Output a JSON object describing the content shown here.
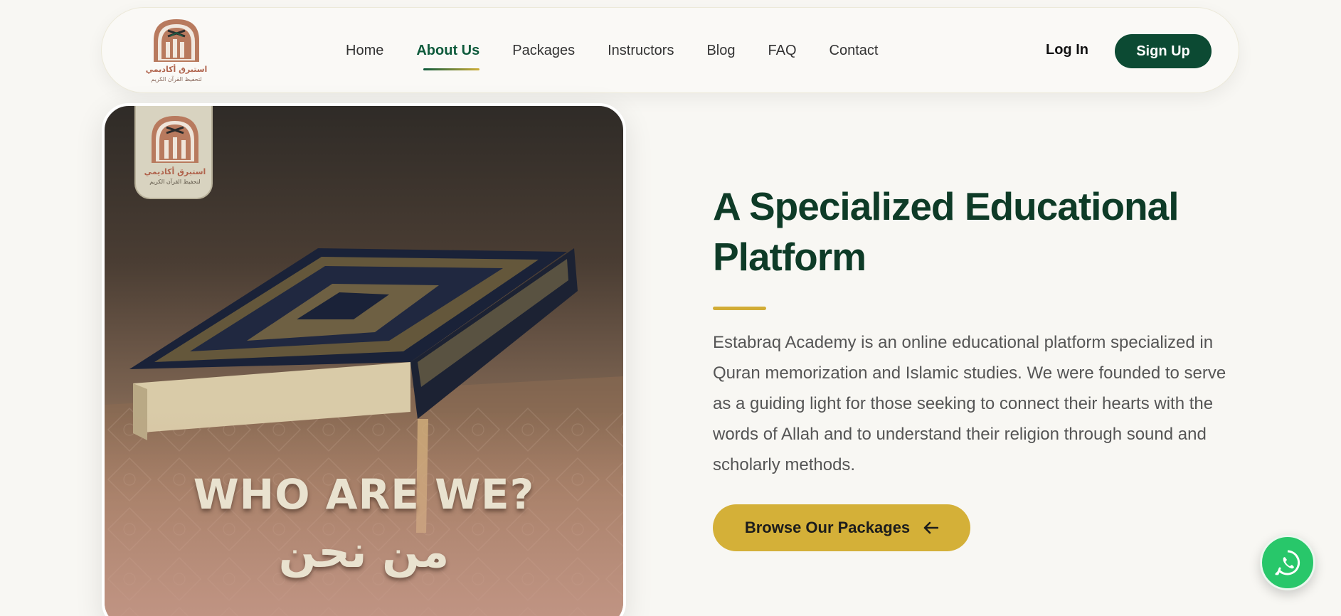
{
  "brand": {
    "logo_arabic_name": "استبرق أكاديمي",
    "logo_arabic_tagline": "لتحفيظ القرآن الكريم"
  },
  "nav": {
    "items": [
      {
        "label": "Home",
        "active": false
      },
      {
        "label": "About Us",
        "active": true
      },
      {
        "label": "Packages",
        "active": false
      },
      {
        "label": "Instructors",
        "active": false
      },
      {
        "label": "Blog",
        "active": false
      },
      {
        "label": "FAQ",
        "active": false
      },
      {
        "label": "Contact",
        "active": false
      }
    ],
    "login_label": "Log In",
    "signup_label": "Sign Up"
  },
  "hero_image": {
    "title_en": "WHO ARE WE?",
    "title_ar": "من نحن"
  },
  "about": {
    "heading_line1": "A Specialized Educational",
    "heading_line2": "Platform",
    "description": "Estabraq Academy is an online educational platform specialized in Quran memorization and Islamic studies. We were founded to serve as a guiding light for those seeking to connect their hearts with the words of Allah and to understand their religion through sound and scholarly methods.",
    "cta_label": "Browse Our Packages",
    "cta_icon": "arrow-left-icon"
  },
  "floating": {
    "whatsapp_icon": "whatsapp-icon"
  },
  "colors": {
    "primary_green": "#0c4a33",
    "heading_green": "#0e3b27",
    "gold": "#d4b038",
    "whatsapp_green": "#28c76a",
    "background": "#f8f7f3"
  }
}
